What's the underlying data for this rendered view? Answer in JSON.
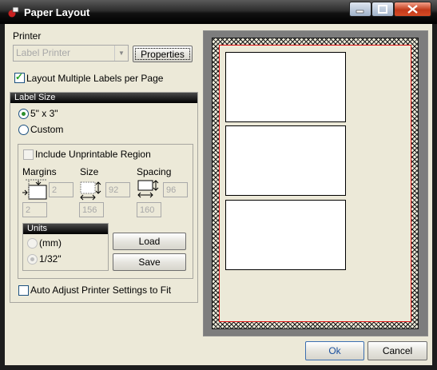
{
  "window": {
    "title": "Paper Layout"
  },
  "printer": {
    "section_label": "Printer",
    "selected": "Label Printer",
    "properties_label": "Properties"
  },
  "layout_multiple": {
    "label": "Layout Multiple Labels per Page",
    "checked": true
  },
  "label_size": {
    "header": "Label Size",
    "options": [
      {
        "label": "5\" x 3\"",
        "selected": true
      },
      {
        "label": "Custom",
        "selected": false
      }
    ],
    "include_unprintable": {
      "label": "Include Unprintable Region",
      "checked": false,
      "enabled": false
    },
    "margins": {
      "label": "Margins",
      "top": "2",
      "left": "2"
    },
    "size": {
      "label": "Size",
      "height": "92",
      "width": "156"
    },
    "spacing": {
      "label": "Spacing",
      "vertical": "96",
      "horizontal": "160"
    },
    "units": {
      "header": "Units",
      "options": [
        {
          "label": "(mm)",
          "selected": false
        },
        {
          "label": "1/32\"",
          "selected": true
        }
      ]
    },
    "load_label": "Load",
    "save_label": "Save"
  },
  "auto_adjust": {
    "label": "Auto Adjust Printer Settings to Fit",
    "checked": false
  },
  "preview": {
    "label_count": 3
  },
  "footer": {
    "ok_label": "Ok",
    "cancel_label": "Cancel"
  },
  "colors": {
    "accent_dark": "#000000",
    "margin_line": "#dd1111",
    "dialog_bg": "#ece9d8"
  }
}
